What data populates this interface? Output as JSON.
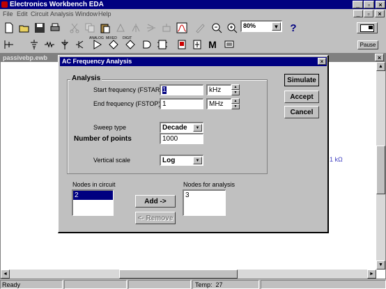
{
  "app": {
    "title": "Electronics Workbench EDA"
  },
  "menu": [
    "File",
    "Edit",
    "Circuit",
    "Analysis",
    "Window",
    "Help"
  ],
  "toolbar": {
    "zoom_value": "80%",
    "help_label": "?",
    "pause_label": "Pause",
    "parts_labels": [
      "ANALOG",
      "MIXED",
      "DIGIT"
    ],
    "m_label": "M"
  },
  "document": {
    "title": "passivebp.ewb",
    "resistor_label": "1 kΩ"
  },
  "dialog": {
    "title": "AC Frequency Analysis",
    "group_label": "Analysis",
    "start_label": "Start frequency (FSTART)",
    "start_value": "1",
    "start_unit": "kHz",
    "end_label": "End frequency (FSTOP)",
    "end_value": "1",
    "end_unit": "MHz",
    "sweep_label": "Sweep type",
    "sweep_value": "Decade",
    "points_label": "Number of points",
    "points_value": "1000",
    "vscale_label": "Vertical scale",
    "vscale_value": "Log",
    "nodes_circuit_label": "Nodes in circuit",
    "nodes_circuit": [
      "2"
    ],
    "nodes_analysis_label": "Nodes for analysis",
    "nodes_analysis": [
      "3"
    ],
    "add_label": "Add ->",
    "remove_label": "<- Remove",
    "simulate_label": "Simulate",
    "accept_label": "Accept",
    "cancel_label": "Cancel"
  },
  "statusbar": {
    "status": "Ready",
    "temp": "Temp:  27"
  }
}
